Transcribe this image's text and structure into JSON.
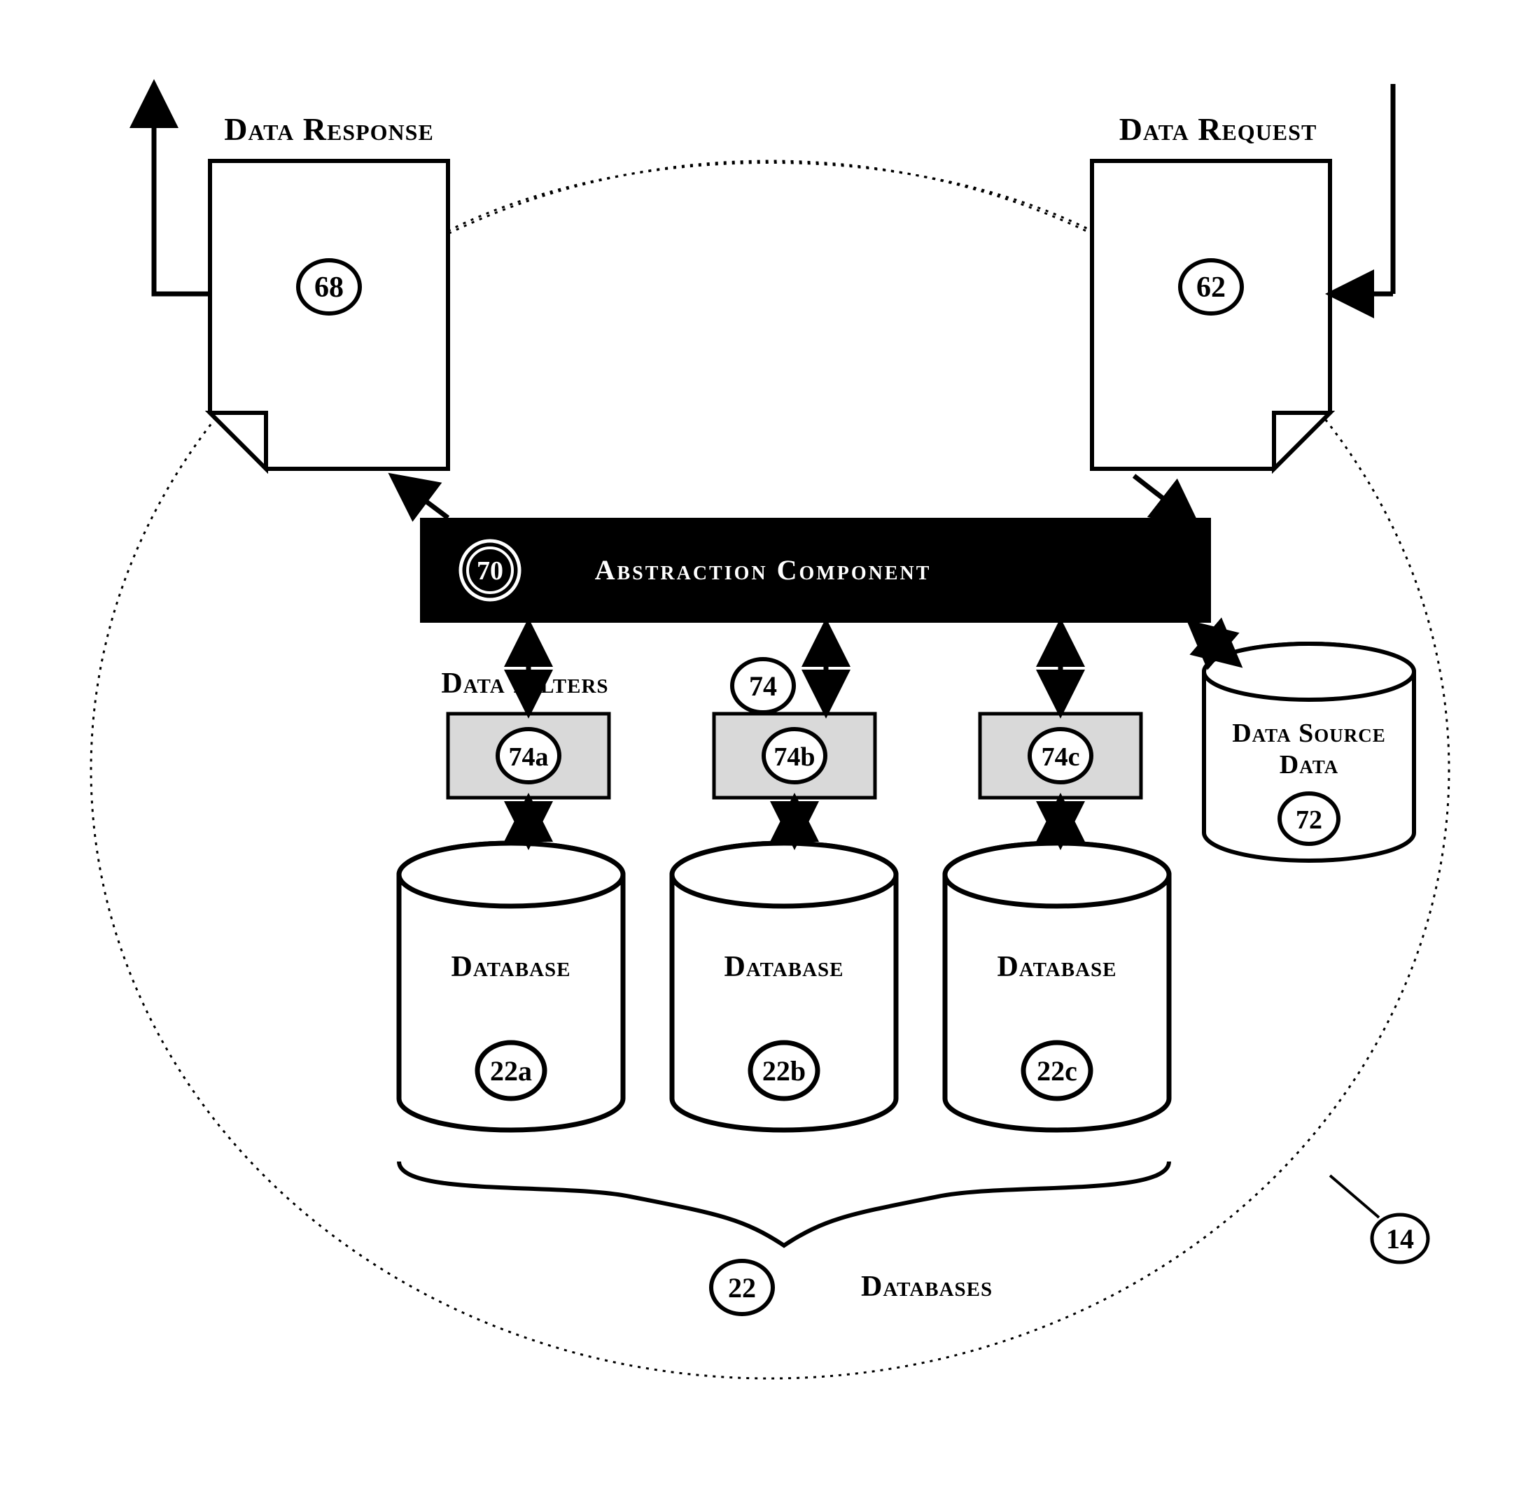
{
  "labels": {
    "data_response": "Data Response",
    "data_request": "Data Request",
    "abstraction_component": "Abstraction Component",
    "data_filters": "Data Filters",
    "data_source_data_l1": "Data Source",
    "data_source_data_l2": "Data",
    "database": "Database",
    "databases": "Databases"
  },
  "refs": {
    "response": "68",
    "request": "62",
    "abstraction": "70",
    "filters_group": "74",
    "filter_a": "74a",
    "filter_b": "74b",
    "filter_c": "74c",
    "source_data": "72",
    "db_a": "22a",
    "db_b": "22b",
    "db_c": "22c",
    "db_group": "22",
    "boundary": "14"
  }
}
